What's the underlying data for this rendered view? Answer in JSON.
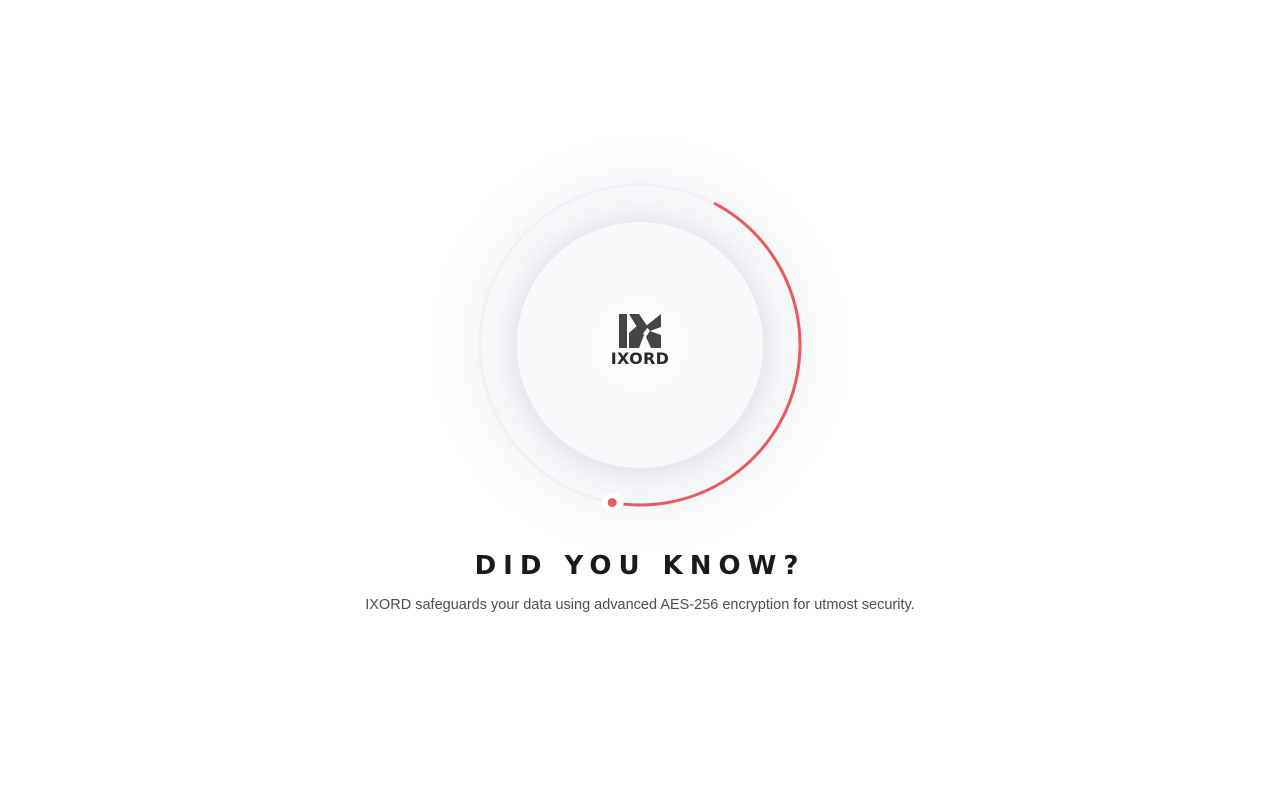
{
  "loader": {
    "progress": 0.45,
    "accent_color": "#e85a5c",
    "track_color": "#f0f1f4"
  },
  "brand": {
    "name": "IXORD",
    "logo_icon": "ixord-logo-icon"
  },
  "tip": {
    "heading": "DID YOU KNOW?",
    "text": "IXORD safeguards your data using advanced AES-256 encryption for utmost security."
  }
}
